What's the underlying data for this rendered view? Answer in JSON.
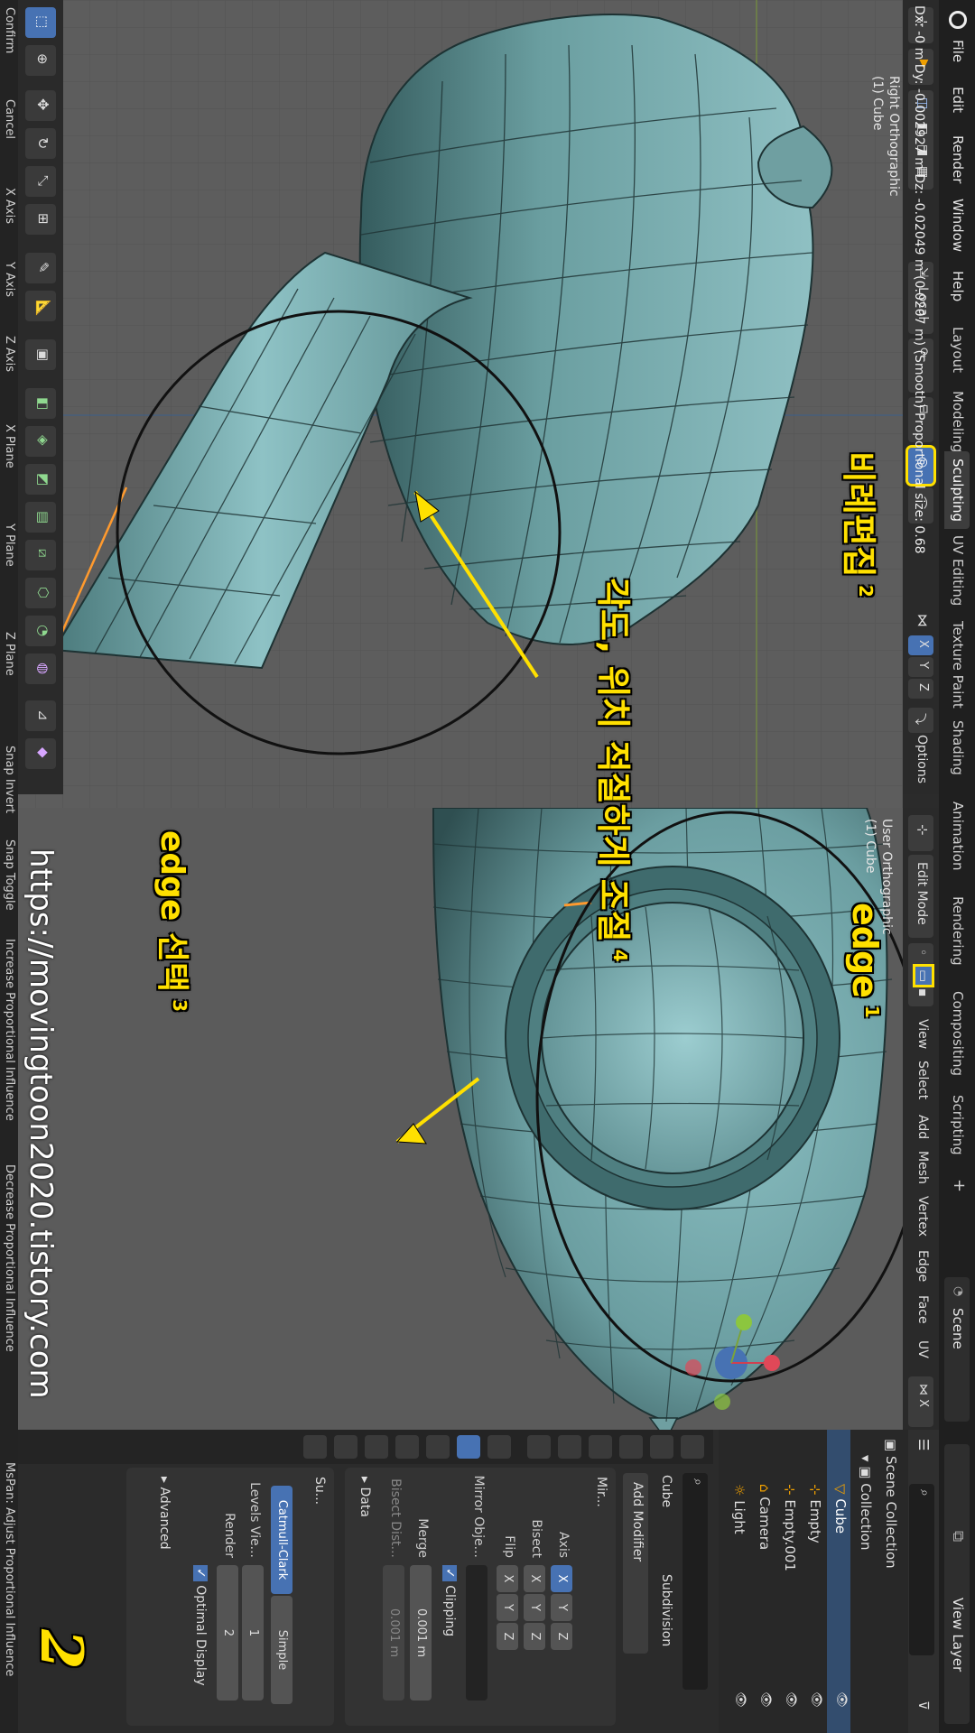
{
  "menu": {
    "file": "File",
    "edit": "Edit",
    "render": "Render",
    "window": "Window",
    "help": "Help"
  },
  "workspaces": [
    "Layout",
    "Modeling",
    "Sculpting",
    "UV Editing",
    "Texture Paint",
    "Shading",
    "Animation",
    "Rendering",
    "Compositing",
    "Scripting"
  ],
  "scene": {
    "label": "Scene",
    "view_layer": "View Layer"
  },
  "left_viewport": {
    "pivot": "Local",
    "axes": {
      "x": "X",
      "y": "Y",
      "z": "Z"
    },
    "options": "Options",
    "transform_info": "Dx: -0 m  Dy: -0.002927 m  Dz: -0.02049 m (0.0207 m) (Smooth)  Proportional size: 0.68",
    "view_name": "Right Orthographic",
    "object_name": "(1) Cube"
  },
  "right_viewport": {
    "mode": "Edit Mode",
    "menus": [
      "View",
      "Select",
      "Add",
      "Mesh",
      "Vertex",
      "Edge",
      "Face",
      "UV"
    ],
    "pivot": "Local",
    "view_name": "User Orthographic",
    "object_name": "(1) Cube",
    "gizmo": {
      "x": "X",
      "y": "Y",
      "z": "Z"
    }
  },
  "outliner": {
    "scene_collection": "Scene Collection",
    "items": [
      "Collection",
      "Cube",
      "Empty",
      "Empty.001",
      "Camera",
      "Light"
    ]
  },
  "properties": {
    "object_name": "Cube",
    "add_modifier": "Add Modifier",
    "subdivision_tab": "Subdivision",
    "mirror": {
      "name": "Mir...",
      "axis_label": "Axis",
      "bisect_label": "Bisect",
      "flip_label": "Flip",
      "x": "X",
      "y": "Y",
      "z": "Z",
      "mirror_object": "Mirror Obje...",
      "clipping": "Clipping",
      "merge_label": "Merge",
      "merge_value": "0.001 m",
      "bisect_dist_label": "Bisect Dist...",
      "bisect_dist_value": "0.001 m",
      "data": "Data"
    },
    "subsurf": {
      "name": "Su...",
      "catmull": "Catmull-Clark",
      "simple": "Simple",
      "levels_label": "Levels Vie...",
      "levels_value": "1",
      "render_label": "Render",
      "render_value": "2",
      "optimal": "Optimal Display",
      "advanced": "Advanced"
    }
  },
  "statusbar": [
    "Confirm",
    "Cancel",
    "X Axis",
    "Y Axis",
    "Z Axis",
    "X Plane",
    "Y Plane",
    "Z Plane",
    "Snap Invert",
    "Snap Toggle",
    "Increase Proportional Influence",
    "Decrease Proportional Influence",
    "MsPan: Adjust Proportional Influence"
  ],
  "annotations": {
    "a1": "edge",
    "n1": "1",
    "a2": "비례편집",
    "n2": "2",
    "a3": "edge 선택",
    "n3": "3",
    "a4": "각도, 위치 적절하게 조절",
    "n4": "4",
    "watermark": "https://movingtoon2020.tistory.com",
    "page_number": "2"
  },
  "colors": {
    "accent": "#4772b3",
    "annotation": "#ffe000",
    "mesh": "#6c9ea0",
    "selected_edge": "#ff9a2e"
  }
}
